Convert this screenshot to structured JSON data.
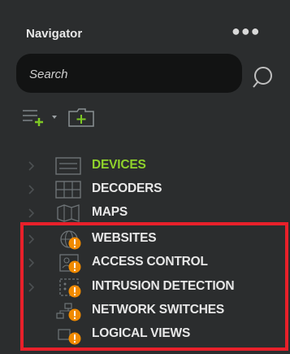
{
  "header": {
    "title": "Navigator",
    "more_label": "●●●"
  },
  "search": {
    "placeholder": "Search"
  },
  "tree": {
    "items": [
      {
        "label": "DEVICES",
        "icon": "list-icon"
      },
      {
        "label": "DECODERS",
        "icon": "grid-icon"
      },
      {
        "label": "MAPS",
        "icon": "map-icon"
      },
      {
        "label": "WEBSITES",
        "icon": "globe-icon",
        "warning": true
      },
      {
        "label": "ACCESS CONTROL",
        "icon": "badge-icon",
        "warning": true
      },
      {
        "label": "INTRUSION DETECTION",
        "icon": "intrusion-icon",
        "warning": true
      },
      {
        "label": "NETWORK SWITCHES",
        "icon": "network-icon",
        "warning": true
      },
      {
        "label": "LOGICAL VIEWS",
        "icon": "logical-view-icon",
        "warning": true
      }
    ]
  },
  "colors": {
    "background": "#2b2d2e",
    "accent_green": "#8fd22b",
    "warning_orange": "#f08a00",
    "highlight_red": "#e8202a"
  }
}
